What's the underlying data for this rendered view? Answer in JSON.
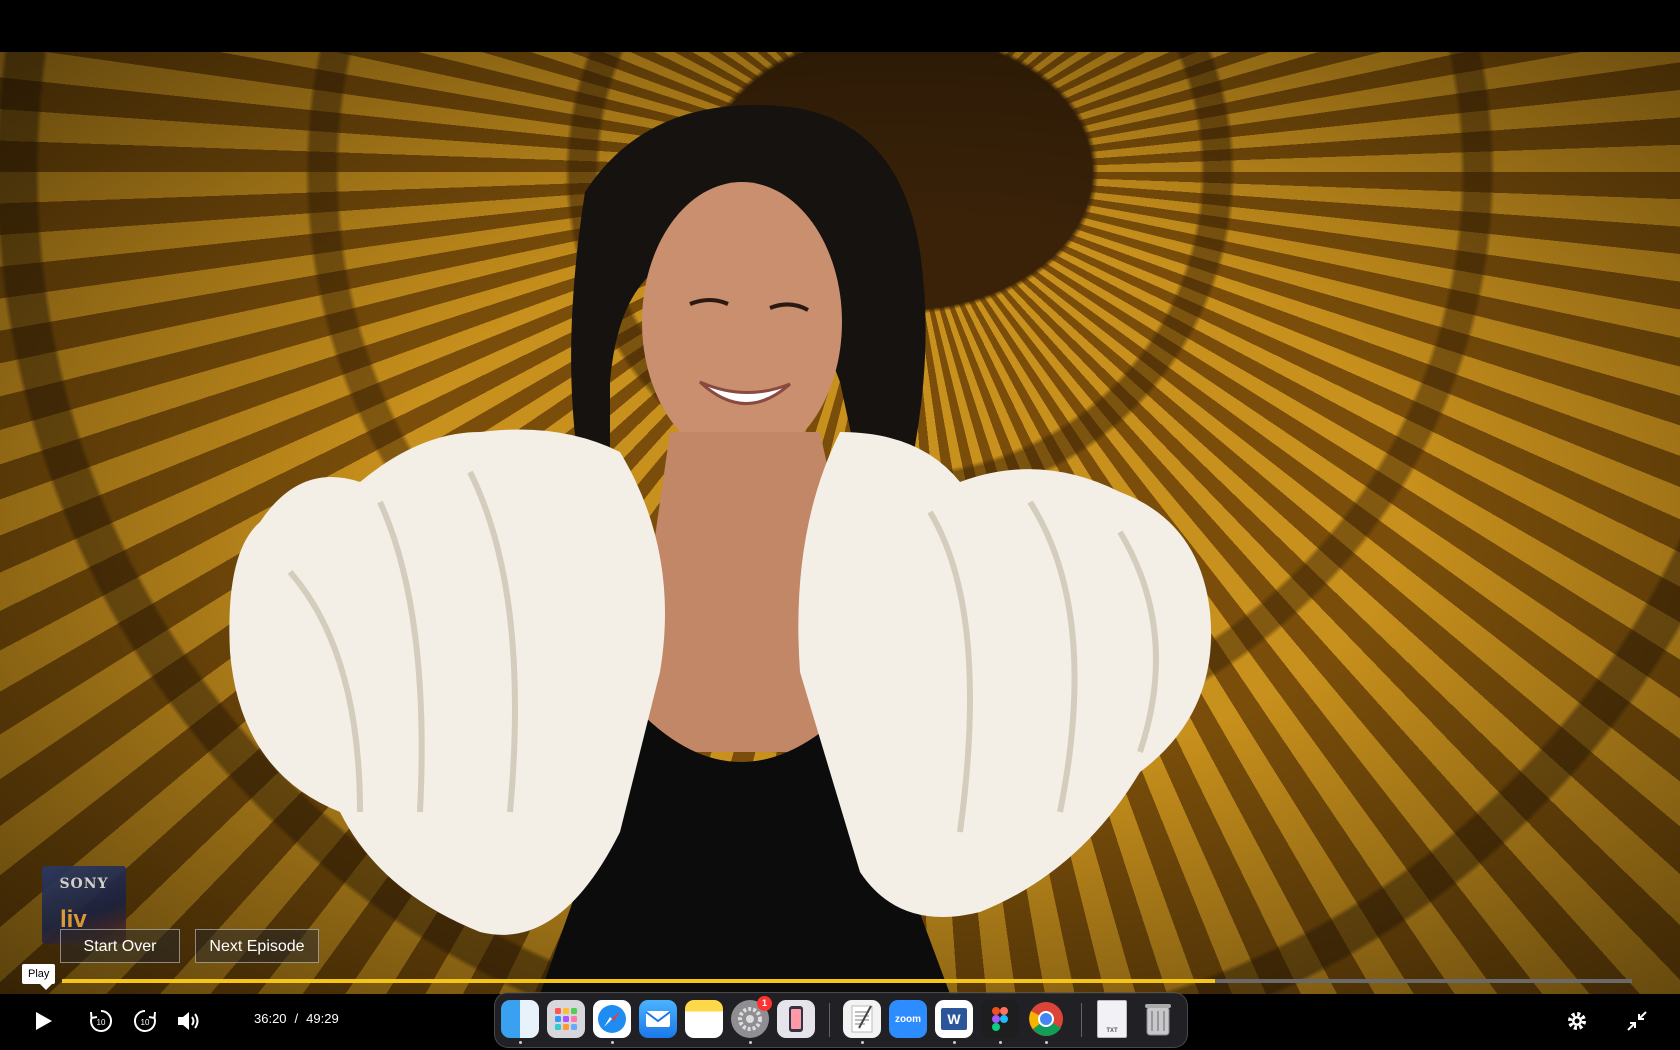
{
  "player": {
    "start_over_label": "Start Over",
    "next_episode_label": "Next Episode",
    "tooltip": "Play",
    "current_time": "36:20",
    "separator": "/",
    "duration": "49:29",
    "progress": 0.7345,
    "accent_color": "#f5c518"
  },
  "logo": {
    "brand": "SONY",
    "sub": "liv"
  },
  "controls": {
    "icons": [
      "play-icon",
      "rewind-10-icon",
      "forward-10-icon",
      "volume-icon",
      "settings-icon",
      "exit-fullscreen-icon"
    ],
    "rewind_label": "10",
    "forward_label": "10"
  },
  "dock": {
    "apps": [
      {
        "name": "finder-icon"
      },
      {
        "name": "launchpad-icon"
      },
      {
        "name": "safari-icon"
      },
      {
        "name": "mail-icon"
      },
      {
        "name": "notes-icon"
      },
      {
        "name": "system-settings-icon",
        "badge": "1"
      },
      {
        "name": "iphone-mirroring-icon"
      },
      {
        "name": "textedit-icon"
      },
      {
        "name": "zoom-icon",
        "label": "zoom"
      },
      {
        "name": "word-icon",
        "label": "W"
      },
      {
        "name": "figma-icon"
      },
      {
        "name": "chrome-icon"
      },
      {
        "name": "txt-document-icon",
        "label": "TXT"
      },
      {
        "name": "trash-icon"
      }
    ]
  }
}
